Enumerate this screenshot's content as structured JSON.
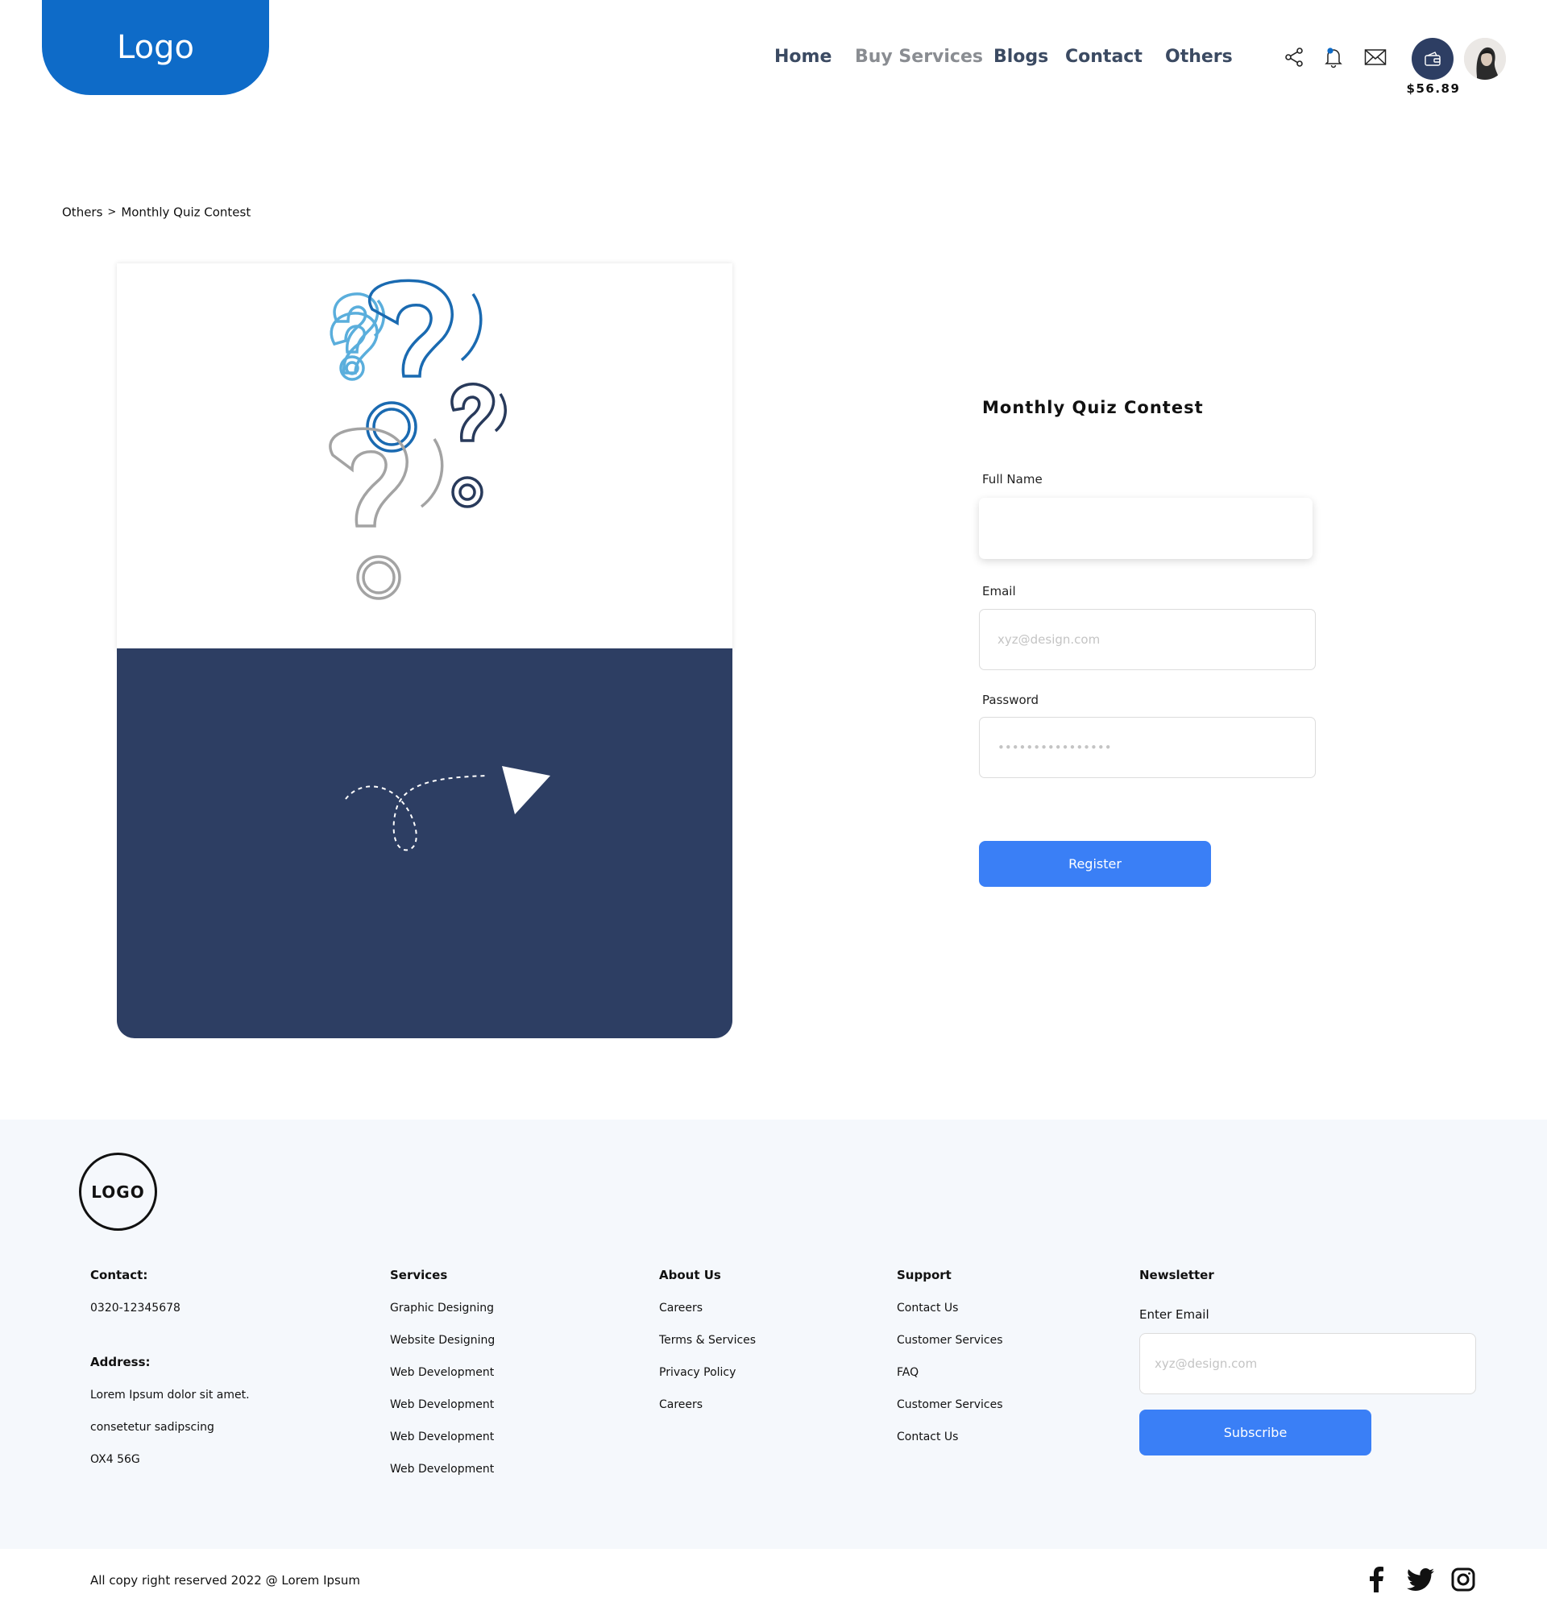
{
  "header": {
    "logo_text": "Logo",
    "nav": [
      {
        "label": "Home",
        "active": false
      },
      {
        "label": "Buy Services",
        "active": true
      },
      {
        "label": "Blogs",
        "active": false
      },
      {
        "label": "Contact",
        "active": false
      },
      {
        "label": "Others",
        "active": false
      }
    ],
    "icons": [
      "share-icon",
      "bell-icon",
      "mail-icon",
      "wallet-icon"
    ],
    "balance": "$56.89",
    "notification_dot_color": "#0e6bc8"
  },
  "breadcrumb": {
    "items": [
      "Others",
      "Monthly Quiz Contest"
    ],
    "separator": ">"
  },
  "illustration": {
    "top_icon": "question-marks-illustration",
    "bottom_icon": "paper-plane-icon",
    "bottom_color": "#2d3e63"
  },
  "form": {
    "title": "Monthly Quiz Contest",
    "fields": {
      "full_name": {
        "label": "Full Name",
        "placeholder": "",
        "value": ""
      },
      "email": {
        "label": "Email",
        "placeholder": "xyz@design.com",
        "value": ""
      },
      "password": {
        "label": "Password",
        "placeholder": "••••••••••••••••",
        "value": ""
      }
    },
    "submit_label": "Register",
    "accent": "#3a7ff6"
  },
  "footer": {
    "logo_text": "LOGO",
    "contact": {
      "title": "Contact:",
      "phone": "0320-12345678",
      "address_title": "Address:",
      "address_lines": [
        "Lorem Ipsum dolor sit amet.",
        "consetetur sadipscing",
        "OX4 56G"
      ]
    },
    "services": {
      "title": "Services",
      "items": [
        "Graphic Designing",
        "Website Designing",
        "Web Development",
        "Web Development",
        "Web Development",
        "Web Development"
      ]
    },
    "about": {
      "title": "About Us",
      "items": [
        "Careers",
        "Terms & Services",
        "Privacy Policy",
        "Careers"
      ]
    },
    "support": {
      "title": "Support",
      "items": [
        "Contact Us",
        "Customer Services",
        "FAQ",
        "Customer Services",
        "Contact Us"
      ]
    },
    "newsletter": {
      "title": "Newsletter",
      "label": "Enter Email",
      "placeholder": "xyz@design.com",
      "button": "Subscribe"
    },
    "copyright": "All copy right reserved 2022 @ Lorem Ipsum",
    "social": [
      "facebook-icon",
      "twitter-icon",
      "instagram-icon"
    ],
    "background": "#f5f8fc"
  }
}
